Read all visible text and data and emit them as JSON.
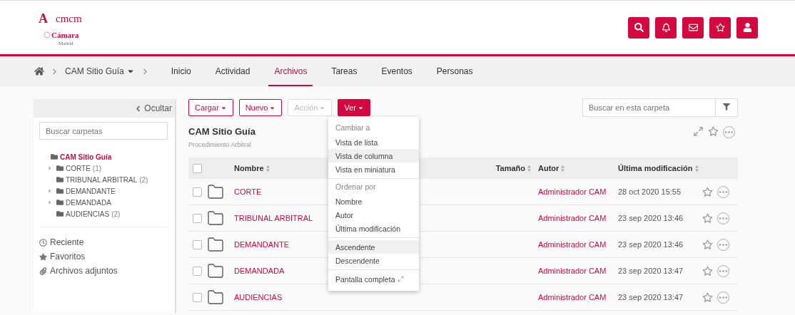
{
  "logo": {
    "mark": "A",
    "brand": "cmcm",
    "name": "Cámara",
    "city": "Madrid"
  },
  "header_buttons": [
    {
      "kind": "search"
    },
    {
      "kind": "bell"
    },
    {
      "kind": "mail"
    },
    {
      "kind": "star"
    },
    {
      "kind": "user"
    }
  ],
  "breadcrumb": {
    "site": "CAM Sitio Guía"
  },
  "nav": [
    {
      "label": "Inicio",
      "selected": false
    },
    {
      "label": "Actividad",
      "selected": false
    },
    {
      "label": "Archivos",
      "selected": true
    },
    {
      "label": "Tareas",
      "selected": false
    },
    {
      "label": "Eventos",
      "selected": false
    },
    {
      "label": "Personas",
      "selected": false
    }
  ],
  "sidebar": {
    "hide": "Ocultar",
    "search_placeholder": "Buscar carpetas",
    "tree": [
      {
        "label": "CAM Sitio Guía",
        "selected": true,
        "children": [
          {
            "label": "CORTE",
            "count": "(1)",
            "has_children": true,
            "selected": false
          },
          {
            "label": "TRIBUNAL ARBITRAL",
            "count": "(2)",
            "has_children": false,
            "selected": false
          },
          {
            "label": "DEMANDANTE",
            "has_children": true,
            "selected": false
          },
          {
            "label": "DEMANDADA",
            "has_children": true,
            "selected": false
          },
          {
            "label": "AUDIENCIAS",
            "count": "(2)",
            "has_children": false,
            "selected": false
          }
        ]
      }
    ],
    "links": [
      {
        "kind": "clock",
        "label": "Reciente"
      },
      {
        "kind": "star",
        "label": "Favoritos"
      },
      {
        "kind": "clip",
        "label": "Archivos adjuntos"
      }
    ]
  },
  "toolbar": [
    {
      "label": "Cargar",
      "kind": "outline",
      "disabled": false
    },
    {
      "label": "Nuevo",
      "kind": "outline",
      "disabled": false
    },
    {
      "label": "Acción",
      "kind": "outline",
      "disabled": true
    },
    {
      "label": "Ver",
      "kind": "solid",
      "disabled": false
    }
  ],
  "folder_search": {
    "placeholder": "Buscar en esta carpeta"
  },
  "folder": {
    "title": "CAM Sitio Guía",
    "subtitle": "Procedimiento Arbitral"
  },
  "view_menu": [
    {
      "header": "Cambiar a",
      "items": [
        {
          "label": "Vista de lista",
          "selected": false
        },
        {
          "label": "Vista de columna",
          "selected": true
        },
        {
          "label": "Vista en miniatura",
          "selected": false
        }
      ]
    },
    {
      "header": "Ordenar por",
      "items": [
        {
          "label": "Nombre",
          "selected": false
        },
        {
          "label": "Autor",
          "selected": false
        },
        {
          "label": "Última modificación",
          "selected": false
        }
      ]
    },
    {
      "items": [
        {
          "label": "Ascendente",
          "selected": true
        },
        {
          "label": "Descendente",
          "selected": false
        }
      ]
    },
    {
      "items": [
        {
          "label": "Pantalla completa",
          "selected": false,
          "kind": "fullscreen"
        }
      ]
    }
  ],
  "table": {
    "all_checked": false,
    "columns": [
      "Nombre",
      "Tamaño",
      "Autor",
      "Última modificación"
    ],
    "rows": [
      {
        "name": "CORTE",
        "author": "Administrador CAM",
        "modified": "28 oct 2020 15:55",
        "checked": false
      },
      {
        "name": "TRIBUNAL ARBITRAL",
        "author": "Administrador CAM",
        "modified": "23 sep 2020 13:46",
        "checked": false
      },
      {
        "name": "DEMANDANTE",
        "author": "Administrador CAM",
        "modified": "23 sep 2020 13:46",
        "checked": false
      },
      {
        "name": "DEMANDADA",
        "author": "Administrador CAM",
        "modified": "23 sep 2020 13:47",
        "checked": false
      },
      {
        "name": "AUDIENCIAS",
        "author": "Administrador CAM",
        "modified": "23 sep 2020 13:47",
        "checked": false
      }
    ]
  }
}
